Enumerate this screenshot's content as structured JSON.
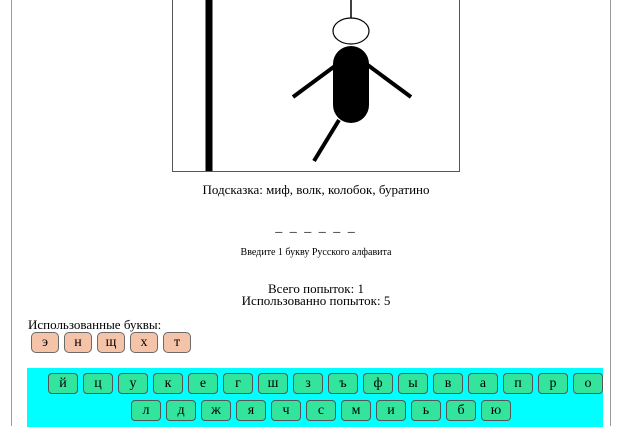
{
  "hint": "Подсказка: миф, волк, колобок, буратино",
  "word_mask": "_ _ _ _ _ _",
  "instruction": "Введите 1 букву Русского алфавита",
  "tries_total": "Всего попыток: 1",
  "tries_used": "Использованно попыток: 5",
  "used_letters_label": "Использованные буквы:",
  "used_letters": [
    "э",
    "н",
    "щ",
    "х",
    "т"
  ],
  "keyboard_row_1": [
    "й",
    "ц",
    "у",
    "к",
    "е",
    "г",
    "ш",
    "з",
    "ъ",
    "ф",
    "ы",
    "в",
    "а",
    "п",
    "р",
    "о"
  ],
  "keyboard_row_2": [
    "л",
    "д",
    "ж",
    "я",
    "ч",
    "с",
    "м",
    "и",
    "ь",
    "б",
    "ю"
  ],
  "colors": {
    "keyboard_bg": "#00ffff",
    "key_bg": "#33e59c",
    "used_key_bg": "#f5c4a8"
  }
}
